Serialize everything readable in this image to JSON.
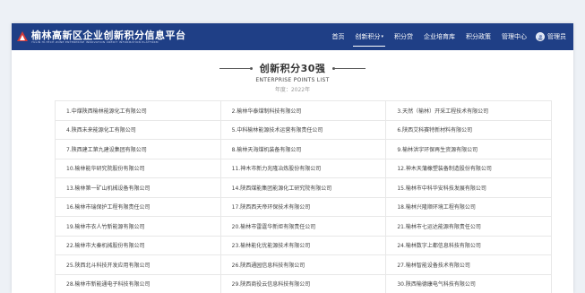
{
  "header": {
    "logo_title": "榆林高新区企业创新积分信息平台",
    "logo_subtitle": "YULIN HI-TECH ZONE ENTERPRISE INNOVATION CREDIT INFORMATION PLATFORM",
    "nav": [
      {
        "label": "首页",
        "active": false,
        "dropdown": false
      },
      {
        "label": "创新积分",
        "active": true,
        "dropdown": true
      },
      {
        "label": "积分贷",
        "active": false,
        "dropdown": false
      },
      {
        "label": "企业培育库",
        "active": false,
        "dropdown": false
      },
      {
        "label": "积分政策",
        "active": false,
        "dropdown": false
      },
      {
        "label": "管理中心",
        "active": false,
        "dropdown": false
      }
    ],
    "user_name": "管理员",
    "caret": "▾"
  },
  "section": {
    "title": "创新积分30强",
    "subtitle_en": "ENTERPRISE POINTS LIST",
    "year": "年度：2022年"
  },
  "companies": [
    [
      "1.中煤陕西榆林能源化工有限公司",
      "2.榆林华泰煤制科技有限公司",
      "3.天然（榆林）开采工程技术有限公司"
    ],
    [
      "4.陕西未来能源化工有限公司",
      "5.中科榆林能源技术运营有限责任公司",
      "6.陕西艾科赛特新材料有限公司"
    ],
    [
      "7.陕西建工第九建设集团有限公司",
      "8.榆林天海煤机装备有限公司",
      "9.榆林洪宇环保再生资源有限公司"
    ],
    [
      "10.榆林能华研究院股份有限公司",
      "11.神木市新力兆隆冶炼股份有限公司",
      "12.神木天蒲橡塑装备制造股份有限公司"
    ],
    [
      "13.榆林第一矿山机械设备有限公司",
      "14.陕西煤能集团能源化工研究院有限公司",
      "15.榆林市中科华安科技发展有限公司"
    ],
    [
      "16.榆林市瑞保护工程有限责任公司",
      "17.陕西西天帝环保技术有限公司",
      "18.榆林兴隆顺环境工程有限公司"
    ],
    [
      "19.榆林市衣人竹新能源有限公司",
      "20.榆林市雷霆华新炬有限责任公司",
      "21.榆林市七运达能源有限责任公司"
    ],
    [
      "22.榆林市大秦机械股份有限公司",
      "23.榆林能化优能源技术有限公司",
      "24.榆林数字上都信息科技有限公司"
    ],
    [
      "25.陕西北斗科技开发应用有限公司",
      "26.陕西通园信息科技有限公司",
      "27.榆林智能设备技术有限公司"
    ],
    [
      "28.榆林市新能通电子科技有限公司",
      "29.陕西商役云信息科技有限公司",
      "30.陕西榆德康电气科技有限公司"
    ]
  ],
  "colors": {
    "header_bg": "#1f3f86",
    "page_bg": "#edf1f6",
    "logo_mark": "#d13a3a"
  }
}
